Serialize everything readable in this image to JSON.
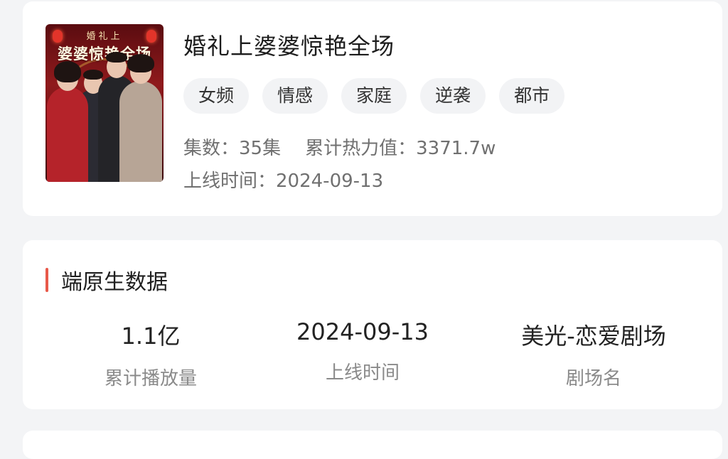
{
  "drama": {
    "poster": {
      "title_top": "婚礼上",
      "title_main": "婆婆惊艳全场"
    },
    "title": "婚礼上婆婆惊艳全场",
    "tags": [
      "女频",
      "情感",
      "家庭",
      "逆袭",
      "都市"
    ],
    "episodes_label": "集数：",
    "episodes_value": "35集",
    "heat_label": "累计热力值：",
    "heat_value": "3371.7w",
    "release_label": "上线时间：",
    "release_value": "2024-09-13"
  },
  "native": {
    "section_title": "端原生数据",
    "accent_color": "#e8594a",
    "stats": [
      {
        "value": "1.1亿",
        "label": "累计播放量"
      },
      {
        "value": "2024-09-13",
        "label": "上线时间"
      },
      {
        "value": "美光-恋爱剧场",
        "label": "剧场名"
      }
    ]
  }
}
